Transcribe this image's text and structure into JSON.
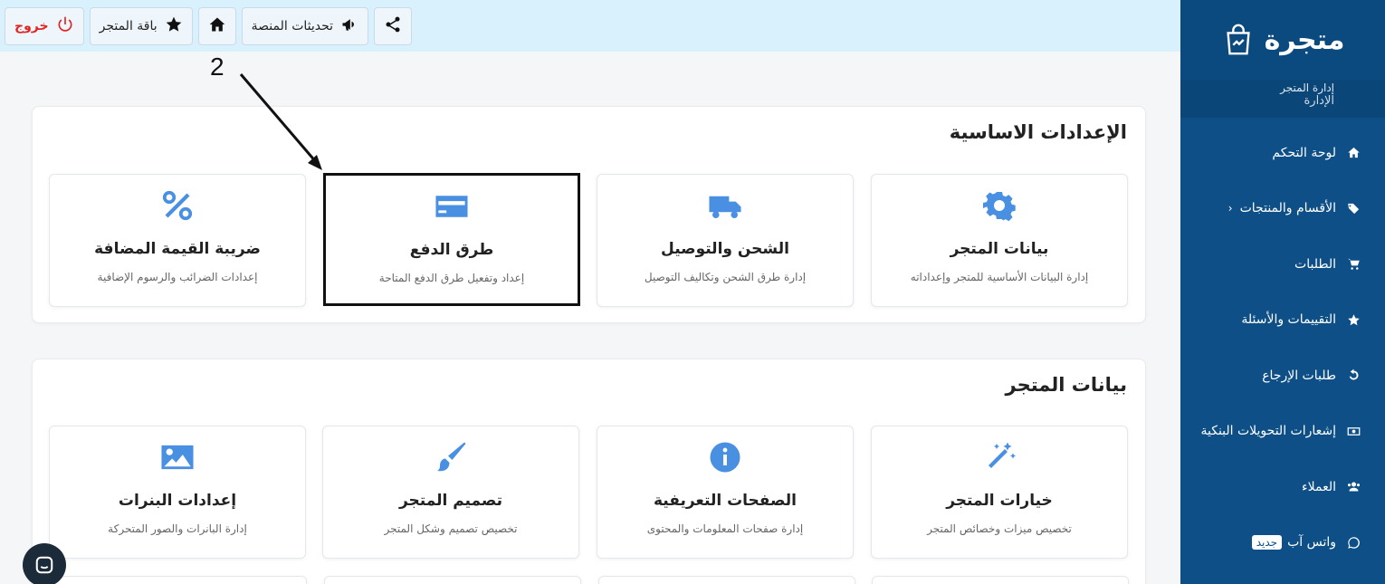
{
  "sidebar": {
    "logo": "متجرة",
    "section_title": "إدارة المتجر",
    "section_sub": "الإدارة",
    "items": [
      {
        "label": "لوحة التحكم",
        "icon": "home-icon"
      },
      {
        "label": "الأقسام والمنتجات",
        "icon": "tags-icon",
        "chevron": "‹"
      },
      {
        "label": "الطلبات",
        "icon": "cart-icon"
      },
      {
        "label": "التقييمات والأسئلة",
        "icon": "star-icon"
      },
      {
        "label": "طلبات الإرجاع",
        "icon": "undo-icon"
      },
      {
        "label": "إشعارات التحويلات البنكية",
        "icon": "money-icon"
      },
      {
        "label": "العملاء",
        "icon": "users-icon"
      },
      {
        "label": "واتس آب",
        "icon": "whatsapp-icon",
        "badge": "جديد"
      }
    ]
  },
  "topbar": {
    "logout": "خروج",
    "package": "باقة المتجر",
    "updates": "تحديثات المنصة"
  },
  "annotation": {
    "number": "2"
  },
  "sections": [
    {
      "title": "الإعدادات الاساسية",
      "cards": [
        {
          "title": "بيانات المتجر",
          "desc": "إدارة البيانات الأساسية للمتجر وإعداداته",
          "icon": "gear-icon"
        },
        {
          "title": "الشحن والتوصيل",
          "desc": "إدارة طرق الشحن وتكاليف التوصيل",
          "icon": "truck-icon"
        },
        {
          "title": "طرق الدفع",
          "desc": "إعداد وتفعيل طرق الدفع المتاحة",
          "icon": "credit-card-icon"
        },
        {
          "title": "ضريبة القيمة المضافة",
          "desc": "إعدادات الضرائب والرسوم الإضافية",
          "icon": "percent-icon"
        }
      ]
    },
    {
      "title": "بيانات المتجر",
      "cards": [
        {
          "title": "خيارات المتجر",
          "desc": "تخصيص ميزات وخصائص المتجر",
          "icon": "magic-wand-icon"
        },
        {
          "title": "الصفحات التعريفية",
          "desc": "إدارة صفحات المعلومات والمحتوى",
          "icon": "info-icon"
        },
        {
          "title": "تصميم المتجر",
          "desc": "تخصيص تصميم وشكل المتجر",
          "icon": "paintbrush-icon"
        },
        {
          "title": "إعدادات البنرات",
          "desc": "إدارة البانرات والصور المتحركة",
          "icon": "image-icon"
        }
      ]
    }
  ],
  "colors": {
    "sidebar": "#0d4f86",
    "topbar": "#d9f1fd",
    "accent_icon": "#4a90e2",
    "logout": "#e02424"
  }
}
